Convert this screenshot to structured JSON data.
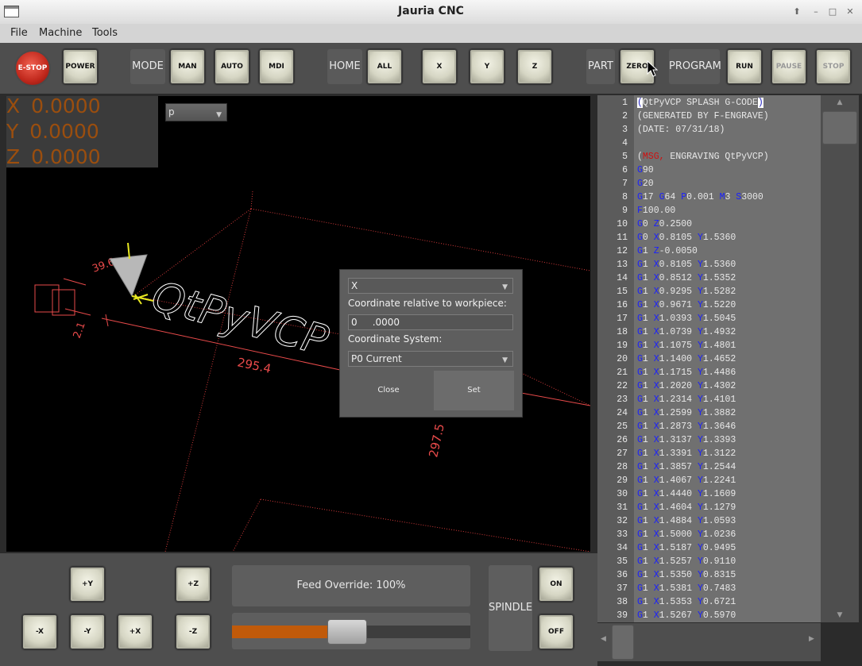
{
  "window": {
    "title": "Jauria CNC"
  },
  "menubar": {
    "items": [
      "File",
      "Machine",
      "Tools"
    ]
  },
  "toolbar": {
    "estop": "E-STOP",
    "power": "POWER",
    "mode_label": "MODE",
    "man": "MAN",
    "auto": "AUTO",
    "mdi": "MDI",
    "home_label": "HOME",
    "all": "ALL",
    "x": "X",
    "y": "Y",
    "z": "Z",
    "part_label": "PART",
    "zero": "ZERO",
    "program_label": "PROGRAM",
    "run": "RUN",
    "pause": "PAUSE",
    "stop": "STOP"
  },
  "dro": {
    "x": {
      "axis": "X",
      "value": "0.0000"
    },
    "y": {
      "axis": "Y",
      "value": "0.0000"
    },
    "z": {
      "axis": "Z",
      "value": "0.0000"
    }
  },
  "viewport": {
    "view_select": "p",
    "dim_length": "295.4",
    "dim_depth": "297.5",
    "dim_height": "39.6",
    "dim_small": "2.1",
    "preview_text": "QtPyVCP"
  },
  "dialog": {
    "axis_select": "X",
    "coord_label": "Coordinate relative to workpiece:",
    "coord_value": "0     .0000",
    "system_label": "Coordinate System:",
    "system_select": "P0 Current",
    "close": "Close",
    "set": "Set"
  },
  "gcode": [
    {
      "n": "1",
      "parts": [
        [
          "hl",
          "("
        ],
        [
          "cm",
          "QtPyVCP SPLASH G-CODE"
        ],
        [
          "hl",
          ")"
        ]
      ]
    },
    {
      "n": "2",
      "parts": [
        [
          "cm",
          "(GENERATED BY F-ENGRAVE)"
        ]
      ]
    },
    {
      "n": "3",
      "parts": [
        [
          "cm",
          "(DATE: 07/31/18)"
        ]
      ]
    },
    {
      "n": "4",
      "parts": []
    },
    {
      "n": "5",
      "parts": [
        [
          "cm",
          "("
        ],
        [
          "warn",
          "MSG,"
        ],
        [
          "cm",
          " ENGRAVING QtPyVCP)"
        ]
      ]
    },
    {
      "n": "6",
      "parts": [
        [
          "kw",
          "G"
        ],
        [
          "cm",
          "90"
        ]
      ]
    },
    {
      "n": "7",
      "parts": [
        [
          "kw",
          "G"
        ],
        [
          "cm",
          "20"
        ]
      ]
    },
    {
      "n": "8",
      "parts": [
        [
          "kw",
          "G"
        ],
        [
          "cm",
          "17 "
        ],
        [
          "kw",
          "G"
        ],
        [
          "cm",
          "64 "
        ],
        [
          "kw",
          "P"
        ],
        [
          "cm",
          "0.001 "
        ],
        [
          "kw",
          "M"
        ],
        [
          "cm",
          "3 "
        ],
        [
          "kw",
          "S"
        ],
        [
          "cm",
          "3000"
        ]
      ]
    },
    {
      "n": "9",
      "parts": [
        [
          "kw",
          "F"
        ],
        [
          "cm",
          "100.00"
        ]
      ]
    },
    {
      "n": "10",
      "parts": [
        [
          "kw",
          "G"
        ],
        [
          "cm",
          "0 "
        ],
        [
          "kw",
          "Z"
        ],
        [
          "cm",
          "0.2500"
        ]
      ]
    },
    {
      "n": "11",
      "parts": [
        [
          "kw",
          "G"
        ],
        [
          "cm",
          "0 "
        ],
        [
          "kw",
          "X"
        ],
        [
          "cm",
          "0.8105 "
        ],
        [
          "kw",
          "Y"
        ],
        [
          "cm",
          "1.5360"
        ]
      ]
    },
    {
      "n": "12",
      "parts": [
        [
          "kw",
          "G"
        ],
        [
          "cm",
          "1 "
        ],
        [
          "kw",
          "Z"
        ],
        [
          "cm",
          "-0.0050"
        ]
      ]
    },
    {
      "n": "13",
      "parts": [
        [
          "kw",
          "G"
        ],
        [
          "cm",
          "1 "
        ],
        [
          "kw",
          "X"
        ],
        [
          "cm",
          "0.8105 "
        ],
        [
          "kw",
          "Y"
        ],
        [
          "cm",
          "1.5360"
        ]
      ]
    },
    {
      "n": "14",
      "parts": [
        [
          "kw",
          "G"
        ],
        [
          "cm",
          "1 "
        ],
        [
          "kw",
          "X"
        ],
        [
          "cm",
          "0.8512 "
        ],
        [
          "kw",
          "Y"
        ],
        [
          "cm",
          "1.5352"
        ]
      ]
    },
    {
      "n": "15",
      "parts": [
        [
          "kw",
          "G"
        ],
        [
          "cm",
          "1 "
        ],
        [
          "kw",
          "X"
        ],
        [
          "cm",
          "0.9295 "
        ],
        [
          "kw",
          "Y"
        ],
        [
          "cm",
          "1.5282"
        ]
      ]
    },
    {
      "n": "16",
      "parts": [
        [
          "kw",
          "G"
        ],
        [
          "cm",
          "1 "
        ],
        [
          "kw",
          "X"
        ],
        [
          "cm",
          "0.9671 "
        ],
        [
          "kw",
          "Y"
        ],
        [
          "cm",
          "1.5220"
        ]
      ]
    },
    {
      "n": "17",
      "parts": [
        [
          "kw",
          "G"
        ],
        [
          "cm",
          "1 "
        ],
        [
          "kw",
          "X"
        ],
        [
          "cm",
          "1.0393 "
        ],
        [
          "kw",
          "Y"
        ],
        [
          "cm",
          "1.5045"
        ]
      ]
    },
    {
      "n": "18",
      "parts": [
        [
          "kw",
          "G"
        ],
        [
          "cm",
          "1 "
        ],
        [
          "kw",
          "X"
        ],
        [
          "cm",
          "1.0739 "
        ],
        [
          "kw",
          "Y"
        ],
        [
          "cm",
          "1.4932"
        ]
      ]
    },
    {
      "n": "19",
      "parts": [
        [
          "kw",
          "G"
        ],
        [
          "cm",
          "1 "
        ],
        [
          "kw",
          "X"
        ],
        [
          "cm",
          "1.1075 "
        ],
        [
          "kw",
          "Y"
        ],
        [
          "cm",
          "1.4801"
        ]
      ]
    },
    {
      "n": "20",
      "parts": [
        [
          "kw",
          "G"
        ],
        [
          "cm",
          "1 "
        ],
        [
          "kw",
          "X"
        ],
        [
          "cm",
          "1.1400 "
        ],
        [
          "kw",
          "Y"
        ],
        [
          "cm",
          "1.4652"
        ]
      ]
    },
    {
      "n": "21",
      "parts": [
        [
          "kw",
          "G"
        ],
        [
          "cm",
          "1 "
        ],
        [
          "kw",
          "X"
        ],
        [
          "cm",
          "1.1715 "
        ],
        [
          "kw",
          "Y"
        ],
        [
          "cm",
          "1.4486"
        ]
      ]
    },
    {
      "n": "22",
      "parts": [
        [
          "kw",
          "G"
        ],
        [
          "cm",
          "1 "
        ],
        [
          "kw",
          "X"
        ],
        [
          "cm",
          "1.2020 "
        ],
        [
          "kw",
          "Y"
        ],
        [
          "cm",
          "1.4302"
        ]
      ]
    },
    {
      "n": "23",
      "parts": [
        [
          "kw",
          "G"
        ],
        [
          "cm",
          "1 "
        ],
        [
          "kw",
          "X"
        ],
        [
          "cm",
          "1.2314 "
        ],
        [
          "kw",
          "Y"
        ],
        [
          "cm",
          "1.4101"
        ]
      ]
    },
    {
      "n": "24",
      "parts": [
        [
          "kw",
          "G"
        ],
        [
          "cm",
          "1 "
        ],
        [
          "kw",
          "X"
        ],
        [
          "cm",
          "1.2599 "
        ],
        [
          "kw",
          "Y"
        ],
        [
          "cm",
          "1.3882"
        ]
      ]
    },
    {
      "n": "25",
      "parts": [
        [
          "kw",
          "G"
        ],
        [
          "cm",
          "1 "
        ],
        [
          "kw",
          "X"
        ],
        [
          "cm",
          "1.2873 "
        ],
        [
          "kw",
          "Y"
        ],
        [
          "cm",
          "1.3646"
        ]
      ]
    },
    {
      "n": "26",
      "parts": [
        [
          "kw",
          "G"
        ],
        [
          "cm",
          "1 "
        ],
        [
          "kw",
          "X"
        ],
        [
          "cm",
          "1.3137 "
        ],
        [
          "kw",
          "Y"
        ],
        [
          "cm",
          "1.3393"
        ]
      ]
    },
    {
      "n": "27",
      "parts": [
        [
          "kw",
          "G"
        ],
        [
          "cm",
          "1 "
        ],
        [
          "kw",
          "X"
        ],
        [
          "cm",
          "1.3391 "
        ],
        [
          "kw",
          "Y"
        ],
        [
          "cm",
          "1.3122"
        ]
      ]
    },
    {
      "n": "28",
      "parts": [
        [
          "kw",
          "G"
        ],
        [
          "cm",
          "1 "
        ],
        [
          "kw",
          "X"
        ],
        [
          "cm",
          "1.3857 "
        ],
        [
          "kw",
          "Y"
        ],
        [
          "cm",
          "1.2544"
        ]
      ]
    },
    {
      "n": "29",
      "parts": [
        [
          "kw",
          "G"
        ],
        [
          "cm",
          "1 "
        ],
        [
          "kw",
          "X"
        ],
        [
          "cm",
          "1.4067 "
        ],
        [
          "kw",
          "Y"
        ],
        [
          "cm",
          "1.2241"
        ]
      ]
    },
    {
      "n": "30",
      "parts": [
        [
          "kw",
          "G"
        ],
        [
          "cm",
          "1 "
        ],
        [
          "kw",
          "X"
        ],
        [
          "cm",
          "1.4440 "
        ],
        [
          "kw",
          "Y"
        ],
        [
          "cm",
          "1.1609"
        ]
      ]
    },
    {
      "n": "31",
      "parts": [
        [
          "kw",
          "G"
        ],
        [
          "cm",
          "1 "
        ],
        [
          "kw",
          "X"
        ],
        [
          "cm",
          "1.4604 "
        ],
        [
          "kw",
          "Y"
        ],
        [
          "cm",
          "1.1279"
        ]
      ]
    },
    {
      "n": "32",
      "parts": [
        [
          "kw",
          "G"
        ],
        [
          "cm",
          "1 "
        ],
        [
          "kw",
          "X"
        ],
        [
          "cm",
          "1.4884 "
        ],
        [
          "kw",
          "Y"
        ],
        [
          "cm",
          "1.0593"
        ]
      ]
    },
    {
      "n": "33",
      "parts": [
        [
          "kw",
          "G"
        ],
        [
          "cm",
          "1 "
        ],
        [
          "kw",
          "X"
        ],
        [
          "cm",
          "1.5000 "
        ],
        [
          "kw",
          "Y"
        ],
        [
          "cm",
          "1.0236"
        ]
      ]
    },
    {
      "n": "34",
      "parts": [
        [
          "kw",
          "G"
        ],
        [
          "cm",
          "1 "
        ],
        [
          "kw",
          "X"
        ],
        [
          "cm",
          "1.5187 "
        ],
        [
          "kw",
          "Y"
        ],
        [
          "cm",
          "0.9495"
        ]
      ]
    },
    {
      "n": "35",
      "parts": [
        [
          "kw",
          "G"
        ],
        [
          "cm",
          "1 "
        ],
        [
          "kw",
          "X"
        ],
        [
          "cm",
          "1.5257 "
        ],
        [
          "kw",
          "Y"
        ],
        [
          "cm",
          "0.9110"
        ]
      ]
    },
    {
      "n": "36",
      "parts": [
        [
          "kw",
          "G"
        ],
        [
          "cm",
          "1 "
        ],
        [
          "kw",
          "X"
        ],
        [
          "cm",
          "1.5350 "
        ],
        [
          "kw",
          "Y"
        ],
        [
          "cm",
          "0.8315"
        ]
      ]
    },
    {
      "n": "37",
      "parts": [
        [
          "kw",
          "G"
        ],
        [
          "cm",
          "1 "
        ],
        [
          "kw",
          "X"
        ],
        [
          "cm",
          "1.5381 "
        ],
        [
          "kw",
          "Y"
        ],
        [
          "cm",
          "0.7483"
        ]
      ]
    },
    {
      "n": "38",
      "parts": [
        [
          "kw",
          "G"
        ],
        [
          "cm",
          "1 "
        ],
        [
          "kw",
          "X"
        ],
        [
          "cm",
          "1.5353 "
        ],
        [
          "kw",
          "Y"
        ],
        [
          "cm",
          "0.6721"
        ]
      ]
    },
    {
      "n": "39",
      "parts": [
        [
          "kw",
          "G"
        ],
        [
          "cm",
          "1 "
        ],
        [
          "kw",
          "X"
        ],
        [
          "cm",
          "1.5267 "
        ],
        [
          "kw",
          "Y"
        ],
        [
          "cm",
          "0.5970"
        ]
      ]
    }
  ],
  "jog": {
    "y_plus": "+Y",
    "y_minus": "-Y",
    "x_plus": "+X",
    "x_minus": "-X",
    "z_plus": "+Z",
    "z_minus": "-Z"
  },
  "feed": {
    "label": "Feed Override: 100%",
    "value_fraction": 0.48
  },
  "spindle": {
    "label": "SPINDLE",
    "on": "ON",
    "off": "OFF"
  },
  "colors": {
    "dro_text": "#9b4e0e",
    "gcode_keyword": "#1a20ff",
    "toolpath": "#e84a4a",
    "feed_fill": "#c05a0a"
  }
}
